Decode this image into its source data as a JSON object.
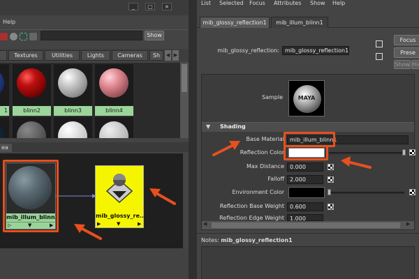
{
  "colors": {
    "accent": "#e8501e",
    "swatch_label_bg": "#9bd59b",
    "node_yellow": "#f5f500"
  },
  "hypershade": {
    "window_buttons": [
      "_",
      "□",
      "×"
    ],
    "menu": [
      "Help"
    ],
    "show_label": "Show",
    "tabs": [
      "Textures",
      "Utilities",
      "Lights",
      "Cameras",
      "Sh"
    ],
    "swatches": [
      {
        "label": "1"
      },
      {
        "label": "blinn2"
      },
      {
        "label": "blinn3"
      },
      {
        "label": "blinn4"
      }
    ],
    "work_area_tab": "ea",
    "nodes": {
      "blinn": {
        "label": "mib_illum_blinn1"
      },
      "glossy": {
        "label": "mib_glossy_re..."
      }
    }
  },
  "attribute_editor": {
    "menu": [
      "List",
      "Selected",
      "Focus",
      "Attributes",
      "Show",
      "Help"
    ],
    "tabs": [
      "mib_glossy_reflection1",
      "mib_illum_blinn1"
    ],
    "node_type_label": "mib_glossy_reflection:",
    "node_name": "mib_glossy_reflection1",
    "buttons": {
      "focus": "Focus",
      "presets": "Prese",
      "show": "Show",
      "hide": "Hide"
    },
    "sample_label": "Sample",
    "sample_logo": "MAYA",
    "section_shading": "Shading",
    "attrs": {
      "base_material_label": "Base Material",
      "base_material_value": "mib_illum_blinn1",
      "reflection_color_label": "Reflection Color",
      "max_distance_label": "Max Distance",
      "max_distance_value": "0.000",
      "falloff_label": "Falloff",
      "falloff_value": "2.000",
      "environment_color_label": "Environment Color",
      "reflection_base_weight_label": "Reflection Base Weight",
      "reflection_base_weight_value": "0.600",
      "reflection_edge_weight_label": "Reflection Edge Weight",
      "reflection_edge_weight_value": "1.000"
    },
    "notes_label": "Notes:",
    "notes_node": "mib_glossy_reflection1"
  }
}
